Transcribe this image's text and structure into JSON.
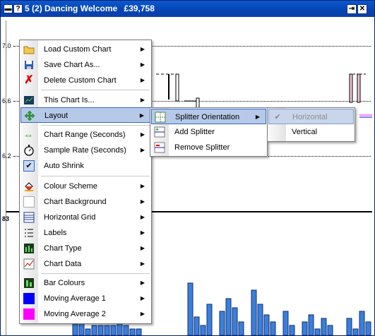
{
  "titlebar": {
    "number": "5",
    "title": "(2) Dancing Welcome",
    "amount": "£39,758",
    "left_button_1": "▬",
    "left_button_2": "?",
    "right_button_1": "⇥",
    "right_button_2": "✕"
  },
  "chart": {
    "y_labels": [
      "7.0",
      "6.6",
      "6.2"
    ],
    "lower_y_label": "83"
  },
  "context_menu": {
    "items": [
      {
        "label": "Load Custom Chart",
        "icon": "folder-icon",
        "submenu": true
      },
      {
        "label": "Save Chart As...",
        "icon": "floppy-disk-icon",
        "submenu": true
      },
      {
        "label": "Delete Custom Chart",
        "icon": "red-x-icon",
        "submenu": true
      },
      {
        "label": "This Chart Is...",
        "icon": "chart-icon",
        "submenu": true
      },
      {
        "label": "Layout",
        "icon": "move-arrows-icon",
        "submenu": true,
        "highlighted": true
      },
      {
        "label": "Chart Range (Seconds)",
        "icon": "horizontal-arrows-icon",
        "submenu": true
      },
      {
        "label": "Sample Rate (Seconds)",
        "icon": "stopwatch-icon",
        "submenu": true
      },
      {
        "label": "Auto Shrink",
        "icon": "checkmark-icon",
        "submenu": false,
        "checked": true
      },
      {
        "label": "Colour Scheme",
        "icon": "paint-bucket-icon",
        "submenu": true
      },
      {
        "label": "Chart Background",
        "icon": "blank-square-icon",
        "submenu": true
      },
      {
        "label": "Horizontal Grid",
        "icon": "grid-lines-icon",
        "submenu": true
      },
      {
        "label": "Labels",
        "icon": "list-icon",
        "submenu": true
      },
      {
        "label": "Chart Type",
        "icon": "chart-type-icon",
        "submenu": true
      },
      {
        "label": "Chart Data",
        "icon": "line-chart-icon",
        "submenu": true
      },
      {
        "label": "Bar Colours",
        "icon": "bar-colours-icon",
        "submenu": true
      },
      {
        "label": "Moving Average 1",
        "icon": "blue-swatch-icon",
        "submenu": true,
        "swatch": "#0000ff"
      },
      {
        "label": "Moving Average 2",
        "icon": "magenta-swatch-icon",
        "submenu": true,
        "swatch": "#ff00ff"
      }
    ]
  },
  "layout_submenu": {
    "items": [
      {
        "label": "Splitter Orientation",
        "icon": "splitter-orientation-icon",
        "submenu": true,
        "highlighted": true
      },
      {
        "label": "Add Splitter",
        "icon": "add-splitter-icon",
        "submenu": false
      },
      {
        "label": "Remove Splitter",
        "icon": "remove-splitter-icon",
        "submenu": false
      }
    ]
  },
  "orientation_submenu": {
    "items": [
      {
        "label": "Horizontal",
        "checked": true,
        "disabled": true
      },
      {
        "label": "Vertical",
        "checked": false,
        "disabled": false
      }
    ]
  },
  "colors": {
    "title_bar": "#0646b4",
    "highlight": "#b6c9e8",
    "highlight_border": "#316ac5",
    "bar_fill": "#3d7fd8",
    "moving_average_1": "#0000ff",
    "moving_average_2": "#ff00ff"
  }
}
